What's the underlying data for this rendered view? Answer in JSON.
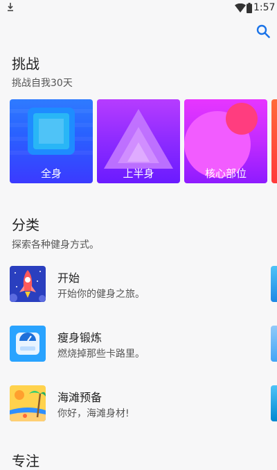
{
  "status_bar": {
    "time": "1:57"
  },
  "challenge": {
    "title": "挑战",
    "subtitle": "挑战自我30天",
    "cards": [
      {
        "label": "全身"
      },
      {
        "label": "上半身"
      },
      {
        "label": "核心部位"
      }
    ]
  },
  "categories": {
    "title": "分类",
    "subtitle": "探索各种健身方式。",
    "items": [
      {
        "title": "开始",
        "description": "开始你的健身之旅。",
        "icon": "rocket-icon"
      },
      {
        "title": "瘦身锻炼",
        "description": "燃烧掉那些卡路里。",
        "icon": "scale-icon"
      },
      {
        "title": "海滩预备",
        "description": "你好，海滩身材!",
        "icon": "beach-icon"
      }
    ]
  },
  "focus": {
    "title": "专注"
  },
  "colors": {
    "accent": "#1a73e8",
    "background": "#f7f7f8"
  }
}
